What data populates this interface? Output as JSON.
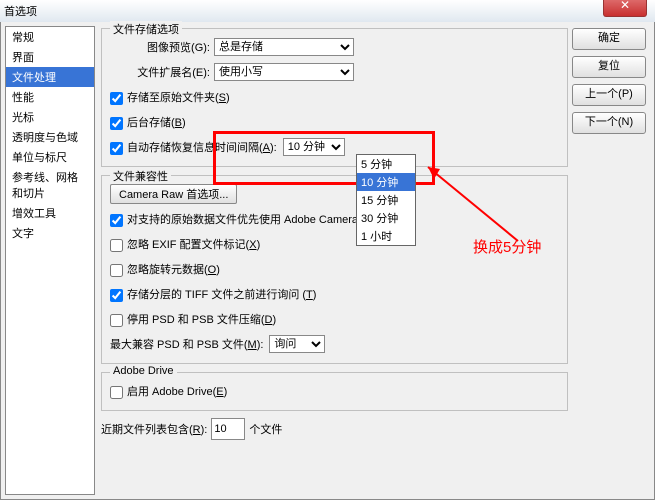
{
  "title": "首选项",
  "sidebar": {
    "items": [
      {
        "label": "常规"
      },
      {
        "label": "界面"
      },
      {
        "label": "文件处理"
      },
      {
        "label": "性能"
      },
      {
        "label": "光标"
      },
      {
        "label": "透明度与色域"
      },
      {
        "label": "单位与标尺"
      },
      {
        "label": "参考线、网格和切片"
      },
      {
        "label": "增效工具"
      },
      {
        "label": "文字"
      }
    ],
    "selected": 2
  },
  "buttons": {
    "ok": "确定",
    "cancel": "复位",
    "prev": "上一个(P)",
    "next": "下一个(N)"
  },
  "group1": {
    "legend": "文件存储选项",
    "imagePreview": {
      "label": "图像预览(G):",
      "value": "总是存储"
    },
    "fileExt": {
      "label": "文件扩展名(E):",
      "value": "使用小写"
    },
    "saveToOriginal": {
      "label": "存储至原始文件夹(",
      "key": "S",
      "suffix": ")",
      "checked": true
    },
    "backgroundSave": {
      "label": "后台存储(",
      "key": "B",
      "suffix": ")",
      "checked": true
    },
    "autoRecovery": {
      "label": "自动存储恢复信息时间间隔(",
      "key": "A",
      "suffix": "):",
      "checked": true,
      "value": "10 分钟",
      "options": [
        "5 分钟",
        "10 分钟",
        "15 分钟",
        "30 分钟",
        "1 小时"
      ]
    }
  },
  "group2": {
    "legend": "文件兼容性",
    "cameraRaw": "Camera Raw 首选项...",
    "preferRaw": {
      "label": "对支持的原始数据文件优先使用 Adobe Camera Raw(",
      "key": "C",
      "suffix": ")",
      "checked": true
    },
    "ignoreExif": {
      "label": "忽略 EXIF 配置文件标记(",
      "key": "X",
      "suffix": ")",
      "checked": false
    },
    "ignoreRotation": {
      "label": "忽略旋转元数据(",
      "key": "O",
      "suffix": ")",
      "checked": false
    },
    "askLayeredTiff": {
      "label": "存储分层的 TIFF 文件之前进行询问 (",
      "key": "T",
      "suffix": ")",
      "checked": true
    },
    "disablePsdComp": {
      "label": "停用 PSD 和 PSB 文件压缩(",
      "key": "D",
      "suffix": ")",
      "checked": false
    },
    "maxCompat": {
      "label": "最大兼容 PSD 和 PSB 文件(",
      "key": "M",
      "suffix": "):",
      "value": "询问"
    }
  },
  "group3": {
    "legend": "Adobe Drive",
    "enable": {
      "label": "启用 Adobe Drive(",
      "key": "E",
      "suffix": ")",
      "checked": false
    }
  },
  "recent": {
    "label": "近期文件列表包含(",
    "key": "R",
    "suffix": "):",
    "value": "10",
    "unit": "个文件"
  },
  "annotation": "换成5分钟"
}
